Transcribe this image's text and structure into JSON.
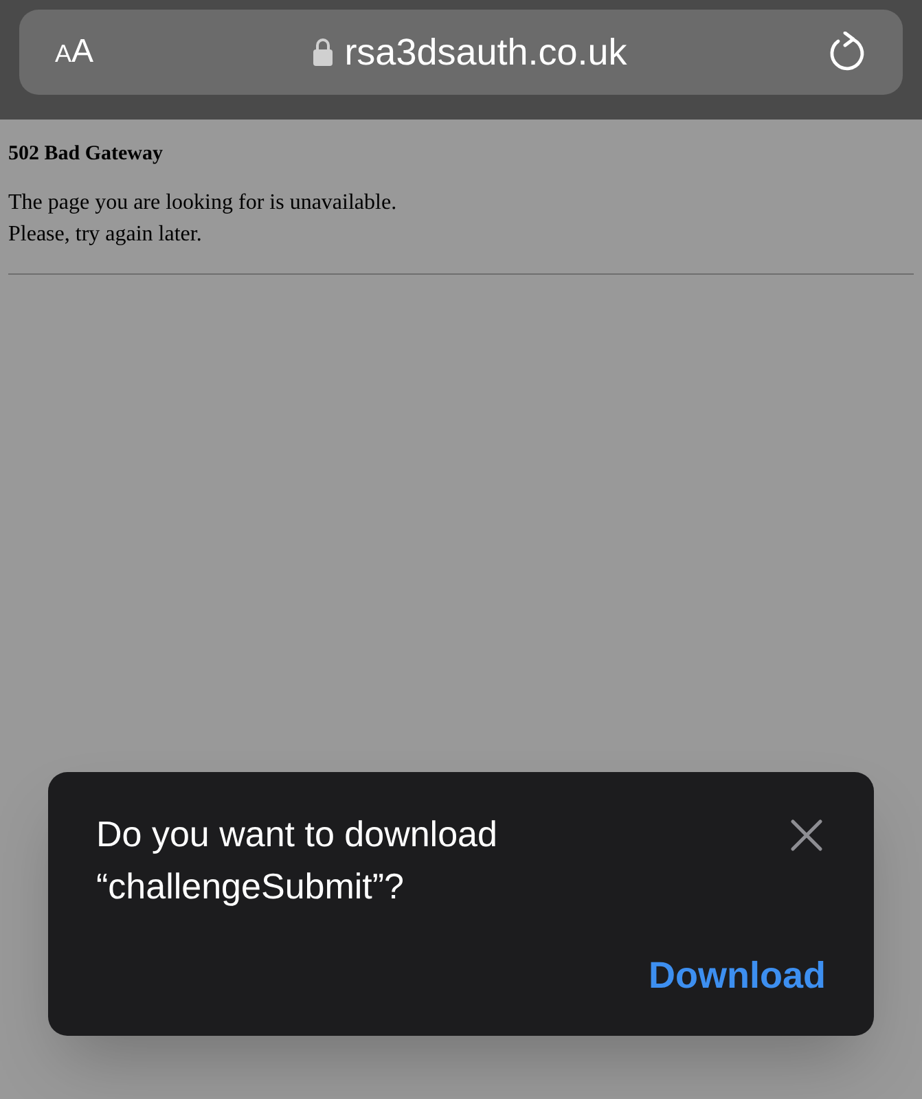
{
  "address_bar": {
    "text_size_button": "AA",
    "secure": true,
    "url": "rsa3dsauth.co.uk"
  },
  "page": {
    "heading": "502 Bad Gateway",
    "lines": [
      "The page you are looking for is unavailable.",
      "Please, try again later."
    ]
  },
  "download_prompt": {
    "message": "Do you want to download “challengeSubmit”?",
    "button": "Download"
  }
}
